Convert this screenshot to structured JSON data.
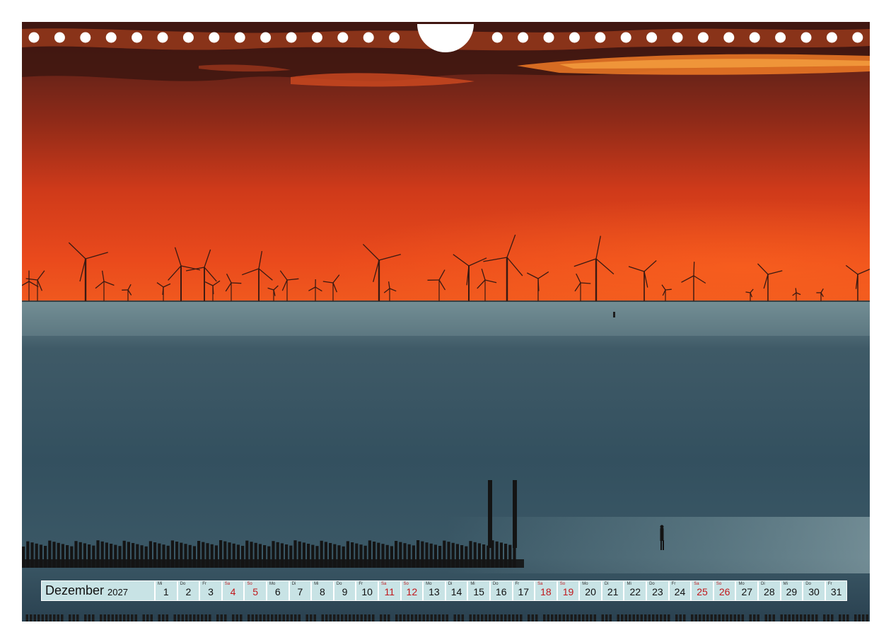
{
  "calendar": {
    "month": "Dezember",
    "year": "2027",
    "days": [
      {
        "wd": "Mi",
        "d": "1",
        "weekend": false
      },
      {
        "wd": "Do",
        "d": "2",
        "weekend": false
      },
      {
        "wd": "Fr",
        "d": "3",
        "weekend": false
      },
      {
        "wd": "Sa",
        "d": "4",
        "weekend": true
      },
      {
        "wd": "So",
        "d": "5",
        "weekend": true
      },
      {
        "wd": "Mo",
        "d": "6",
        "weekend": false
      },
      {
        "wd": "Di",
        "d": "7",
        "weekend": false
      },
      {
        "wd": "Mi",
        "d": "8",
        "weekend": false
      },
      {
        "wd": "Do",
        "d": "9",
        "weekend": false
      },
      {
        "wd": "Fr",
        "d": "10",
        "weekend": false
      },
      {
        "wd": "Sa",
        "d": "11",
        "weekend": true
      },
      {
        "wd": "So",
        "d": "12",
        "weekend": true
      },
      {
        "wd": "Mo",
        "d": "13",
        "weekend": false
      },
      {
        "wd": "Di",
        "d": "14",
        "weekend": false
      },
      {
        "wd": "Mi",
        "d": "15",
        "weekend": false
      },
      {
        "wd": "Do",
        "d": "16",
        "weekend": false
      },
      {
        "wd": "Fr",
        "d": "17",
        "weekend": false
      },
      {
        "wd": "Sa",
        "d": "18",
        "weekend": true
      },
      {
        "wd": "So",
        "d": "19",
        "weekend": true
      },
      {
        "wd": "Mo",
        "d": "20",
        "weekend": false
      },
      {
        "wd": "Di",
        "d": "21",
        "weekend": false
      },
      {
        "wd": "Mi",
        "d": "22",
        "weekend": false
      },
      {
        "wd": "Do",
        "d": "23",
        "weekend": false
      },
      {
        "wd": "Fr",
        "d": "24",
        "weekend": false
      },
      {
        "wd": "Sa",
        "d": "25",
        "weekend": true
      },
      {
        "wd": "So",
        "d": "26",
        "weekend": true
      },
      {
        "wd": "Mo",
        "d": "27",
        "weekend": false
      },
      {
        "wd": "Di",
        "d": "28",
        "weekend": false
      },
      {
        "wd": "Mi",
        "d": "29",
        "weekend": false
      },
      {
        "wd": "Do",
        "d": "30",
        "weekend": false
      },
      {
        "wd": "Fr",
        "d": "31",
        "weekend": false
      }
    ]
  },
  "colors": {
    "sky_dark": "#5a1f16",
    "sky_red": "#e8401a",
    "horizon_orange": "#f25a1e",
    "sea": "#2c4352",
    "calendar_cell": "#c8e3e5",
    "weekend_red": "#c0181c"
  }
}
